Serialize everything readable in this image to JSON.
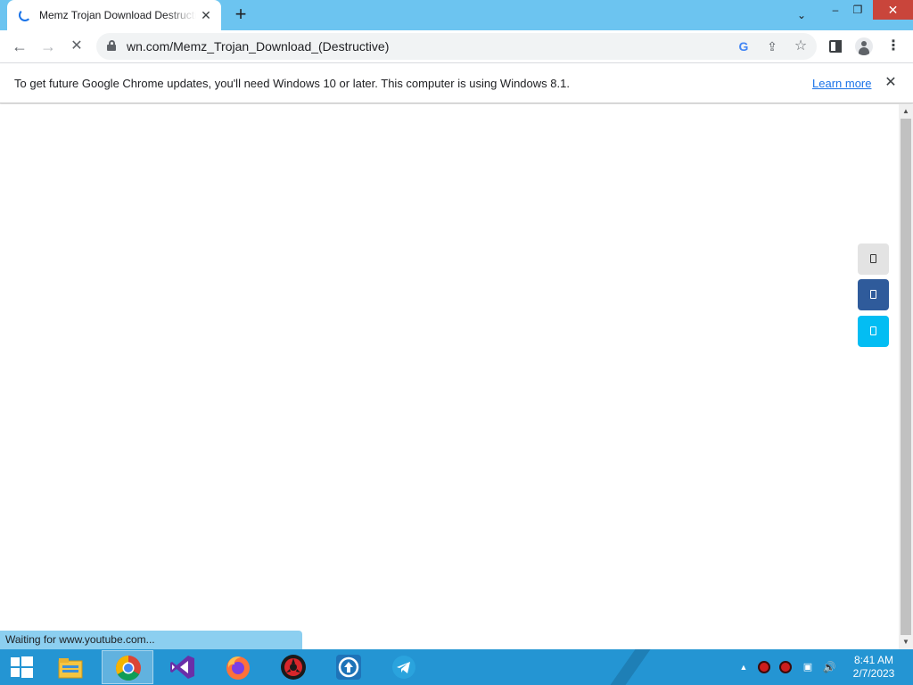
{
  "browser": {
    "tab": {
      "title": "Memz Trojan Download Destructive"
    },
    "newtab_label": "+",
    "window_controls": {
      "tab_search": "⌄",
      "minimize": "–",
      "restore": "❐",
      "close": "✕"
    }
  },
  "toolbar": {
    "back": "←",
    "forward": "→",
    "stop": "✕",
    "url": "wn.com/Memz_Trojan_Download_(Destructive)",
    "google_icon": "G",
    "share_icon": "⇪",
    "bookmark_icon": "☆",
    "menu_icon": "⋮"
  },
  "infobar": {
    "message": "To get future Google Chrome updates, you'll need Windows 10 or later. This computer is using Windows 8.1.",
    "link": "Learn more",
    "close": "✕"
  },
  "page": {
    "share_buttons": [
      {
        "name": "share-button-generic",
        "color": "#e3e3e3"
      },
      {
        "name": "share-button-facebook",
        "color": "#2f5b9b"
      },
      {
        "name": "share-button-twitter",
        "color": "#03bdf3"
      }
    ]
  },
  "status": {
    "text": "Waiting for www.youtube.com..."
  },
  "scrollbar": {
    "up": "▲",
    "down": "▼"
  },
  "taskbar": {
    "apps": [
      "file-explorer",
      "google-chrome",
      "visual-studio",
      "firefox",
      "memz-app",
      "upload-app",
      "telegram"
    ],
    "tray": {
      "expand": "▲",
      "network": "▣",
      "volume": "🔊"
    },
    "clock": {
      "time": "8:41 AM",
      "date": "2/7/2023"
    }
  },
  "colors": {
    "titlebar": "#6cc4f0",
    "taskbar": "#2495d3",
    "link": "#1a73e8",
    "close_hover": "#c9453b"
  }
}
